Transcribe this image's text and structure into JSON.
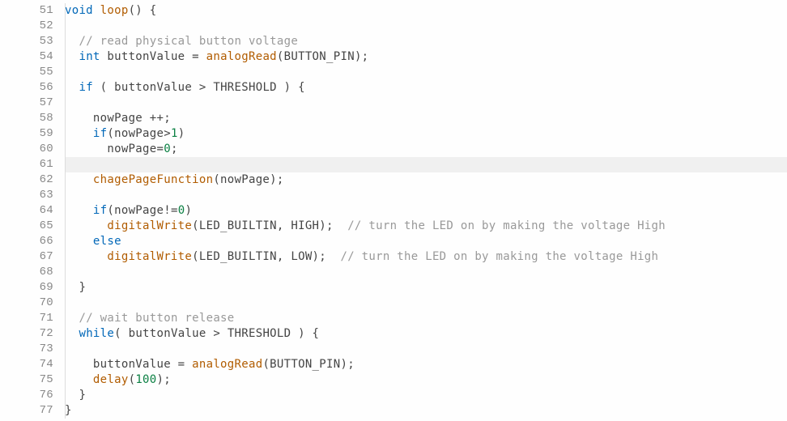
{
  "gutter": {
    "start": 51,
    "end": 77,
    "lines": [
      "51",
      "52",
      "53",
      "54",
      "55",
      "56",
      "57",
      "58",
      "59",
      "60",
      "61",
      "62",
      "63",
      "64",
      "65",
      "66",
      "67",
      "68",
      "69",
      "70",
      "71",
      "72",
      "73",
      "74",
      "75",
      "76",
      "77"
    ]
  },
  "code": {
    "l51": {
      "kw_void": "void",
      "fnname": " loop",
      "paren": "()",
      "brace": " {"
    },
    "l52": {
      "blank": ""
    },
    "l53": {
      "cmt": "// read physical button voltage"
    },
    "l54": {
      "ty": "int",
      "sp": " ",
      "id": "buttonValue ",
      "eq": "= ",
      "fn": "analogRead",
      "open": "(",
      "arg": "BUTTON_PIN",
      "close": ");"
    },
    "l55": {
      "blank": ""
    },
    "l56": {
      "kw": "if",
      "open": " ( ",
      "id": "buttonValue ",
      "op": "> ",
      "cn": "THRESHOLD",
      "close": " ) {"
    },
    "l57": {
      "blank": ""
    },
    "l58": {
      "id": "nowPage ",
      "op": "++;"
    },
    "l59": {
      "kw": "if",
      "open": "(",
      "id": "nowPage",
      "op": ">",
      "nm": "1",
      "close": ")"
    },
    "l60": {
      "id": "nowPage",
      "eq": "=",
      "nm": "0",
      "semi": ";"
    },
    "l61": {
      "blank": ""
    },
    "l62": {
      "fn": "chagePageFunction",
      "open": "(",
      "arg": "nowPage",
      "close": ");"
    },
    "l63": {
      "blank": ""
    },
    "l64": {
      "kw": "if",
      "open": "(",
      "id": "nowPage",
      "op": "!=",
      "nm": "0",
      "close": ")"
    },
    "l65": {
      "fn": "digitalWrite",
      "open": "(",
      "a1": "LED_BUILTIN",
      "comma": ", ",
      "a2": "HIGH",
      "close": ");  ",
      "cmt": "// turn the LED on by making the voltage High"
    },
    "l66": {
      "kw": "else"
    },
    "l67": {
      "fn": "digitalWrite",
      "open": "(",
      "a1": "LED_BUILTIN",
      "comma": ", ",
      "a2": "LOW",
      "close": ");  ",
      "cmt": "// turn the LED on by making the voltage High"
    },
    "l68": {
      "blank": ""
    },
    "l69": {
      "brace": "}"
    },
    "l70": {
      "blank": ""
    },
    "l71": {
      "cmt": "// wait button release"
    },
    "l72": {
      "kw": "while",
      "open": "( ",
      "id": "buttonValue ",
      "op": "> ",
      "cn": "THRESHOLD",
      "close": " ) {"
    },
    "l73": {
      "blank": ""
    },
    "l74": {
      "id": "buttonValue ",
      "eq": "= ",
      "fn": "analogRead",
      "open": "(",
      "arg": "BUTTON_PIN",
      "close": ");"
    },
    "l75": {
      "fn": "delay",
      "open": "(",
      "nm": "100",
      "close": ");"
    },
    "l76": {
      "brace": "}"
    },
    "l77": {
      "brace": "}"
    }
  },
  "highlight_line": 61
}
